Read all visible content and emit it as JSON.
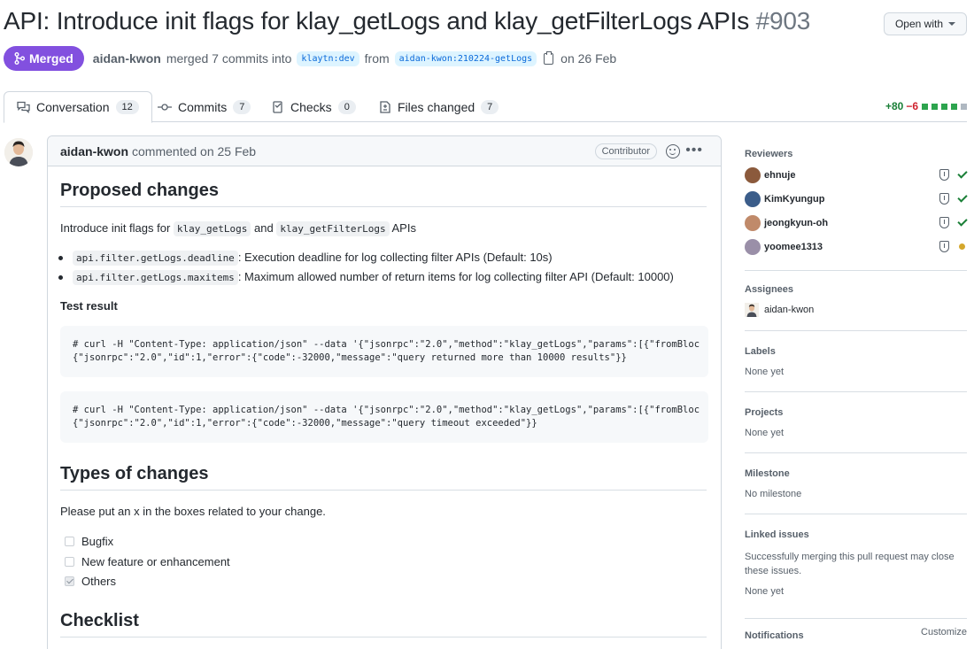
{
  "pr": {
    "title": "API: Introduce init flags for klay_getLogs and klay_getFilterLogs APIs",
    "number": "#903",
    "open_with": "Open with",
    "status": "Merged",
    "author": "aidan-kwon",
    "meta_text": "merged 7 commits into",
    "base_branch": "klaytn:dev",
    "from_text": "from",
    "head_branch": "aidan-kwon:210224-getLogs",
    "date_text": "on 26 Feb"
  },
  "tabs": [
    {
      "label": "Conversation",
      "count": "12"
    },
    {
      "label": "Commits",
      "count": "7"
    },
    {
      "label": "Checks",
      "count": "0"
    },
    {
      "label": "Files changed",
      "count": "7"
    }
  ],
  "diffstat": {
    "additions": "+80",
    "deletions": "−6"
  },
  "comment": {
    "author": "aidan-kwon",
    "when": "commented on 25 Feb",
    "role": "Contributor",
    "h_proposed": "Proposed changes",
    "intro_pre": "Introduce init flags for",
    "intro_code1": "klay_getLogs",
    "intro_and": "and",
    "intro_code2": "klay_getFilterLogs",
    "intro_post": "APIs",
    "bullets": [
      {
        "code": "api.filter.getLogs.deadline",
        "text": ": Execution deadline for log collecting filter APIs (Default: 10s)"
      },
      {
        "code": "api.filter.getLogs.maxitems",
        "text": ": Maximum allowed number of return items for log collecting filter API (Default: 10000)"
      }
    ],
    "test_result": "Test result",
    "code1_line1": "# curl -H \"Content-Type: application/json\" --data '{\"jsonrpc\":\"2.0\",\"method\":\"klay_getLogs\",\"params\":[{\"fromBloc",
    "code1_line2": "{\"jsonrpc\":\"2.0\",\"id\":1,\"error\":{\"code\":-32000,\"message\":\"query returned more than 10000 results\"}}",
    "code2_line1": "# curl -H \"Content-Type: application/json\" --data '{\"jsonrpc\":\"2.0\",\"method\":\"klay_getLogs\",\"params\":[{\"fromBloc",
    "code2_line2": "{\"jsonrpc\":\"2.0\",\"id\":1,\"error\":{\"code\":-32000,\"message\":\"query timeout exceeded\"}}",
    "h_types": "Types of changes",
    "types_intro": "Please put an x in the boxes related to your change.",
    "checks": [
      {
        "label": "Bugfix",
        "checked": false
      },
      {
        "label": "New feature or enhancement",
        "checked": false
      },
      {
        "label": "Others",
        "checked": true
      }
    ],
    "h_checklist": "Checklist"
  },
  "sidebar": {
    "reviewers_title": "Reviewers",
    "reviewers": [
      {
        "name": "ehnuje",
        "state": "approved",
        "color": "#8b5a3c"
      },
      {
        "name": "KimKyungup",
        "state": "approved",
        "color": "#3b5d8a"
      },
      {
        "name": "jeongkyun-oh",
        "state": "approved",
        "color": "#c08a6a"
      },
      {
        "name": "yoomee1313",
        "state": "pending",
        "color": "#9a8fa8"
      }
    ],
    "assignees_title": "Assignees",
    "assignee": "aidan-kwon",
    "labels_title": "Labels",
    "labels_value": "None yet",
    "projects_title": "Projects",
    "projects_value": "None yet",
    "milestone_title": "Milestone",
    "milestone_value": "No milestone",
    "linked_title": "Linked issues",
    "linked_desc": "Successfully merging this pull request may close these issues.",
    "linked_value": "None yet",
    "notifications_title": "Notifications",
    "customize": "Customize"
  }
}
